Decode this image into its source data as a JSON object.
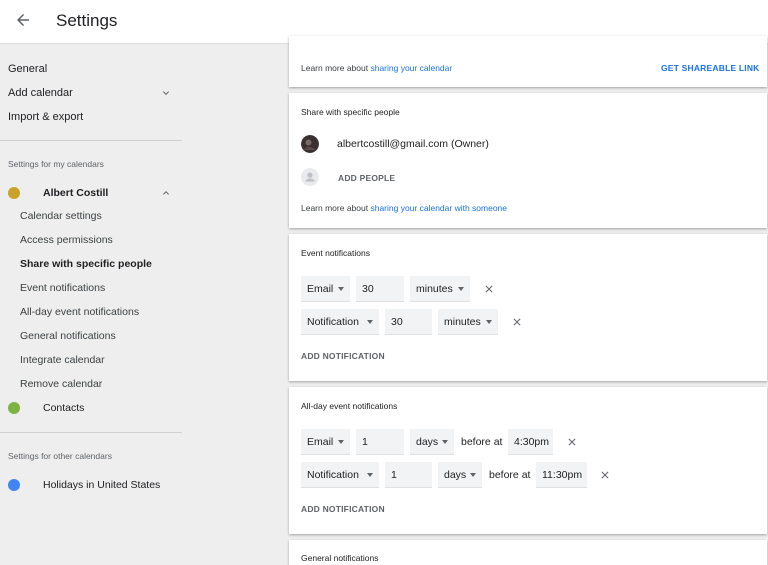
{
  "header": {
    "title": "Settings",
    "back_icon": "arrow-left-icon"
  },
  "sidebar": {
    "general": "General",
    "add_calendar": "Add calendar",
    "import_export": "Import & export",
    "my_calendars_header": "Settings for my calendars",
    "my_calendar": {
      "name": "Albert Costill",
      "color": "#c9a227",
      "items": [
        "Calendar settings",
        "Access permissions",
        "Share with specific people",
        "Event notifications",
        "All-day event notifications",
        "General notifications",
        "Integrate calendar",
        "Remove calendar"
      ],
      "active_item": "Share with specific people"
    },
    "contacts": {
      "name": "Contacts",
      "color": "#7cb342"
    },
    "other_calendars_header": "Settings for other calendars",
    "holidays": {
      "name": "Holidays in United States",
      "color": "#4285f4"
    }
  },
  "share_link_card": {
    "learn_prefix": "Learn more about ",
    "learn_link": "sharing your calendar",
    "action": "GET SHAREABLE LINK"
  },
  "share_people_card": {
    "title": "Share with specific people",
    "owner": "albertcostill@gmail.com (Owner)",
    "add_people": "ADD PEOPLE",
    "learn_prefix": "Learn more about ",
    "learn_link": "sharing your calendar with someone"
  },
  "event_notifications": {
    "title": "Event notifications",
    "rows": [
      {
        "method": "Email",
        "amount": "30",
        "unit": "minutes"
      },
      {
        "method": "Notification",
        "amount": "30",
        "unit": "minutes"
      }
    ],
    "add": "ADD NOTIFICATION"
  },
  "allday_notifications": {
    "title": "All-day event notifications",
    "rows": [
      {
        "method": "Email",
        "amount": "1",
        "unit": "days",
        "before_at": "before at",
        "time": "4:30pm"
      },
      {
        "method": "Notification",
        "amount": "1",
        "unit": "days",
        "before_at": "before at",
        "time": "11:30pm"
      }
    ],
    "add": "ADD NOTIFICATION"
  },
  "general_notifications": {
    "title": "General notifications"
  },
  "colors": {
    "accent": "#1a73e8"
  }
}
